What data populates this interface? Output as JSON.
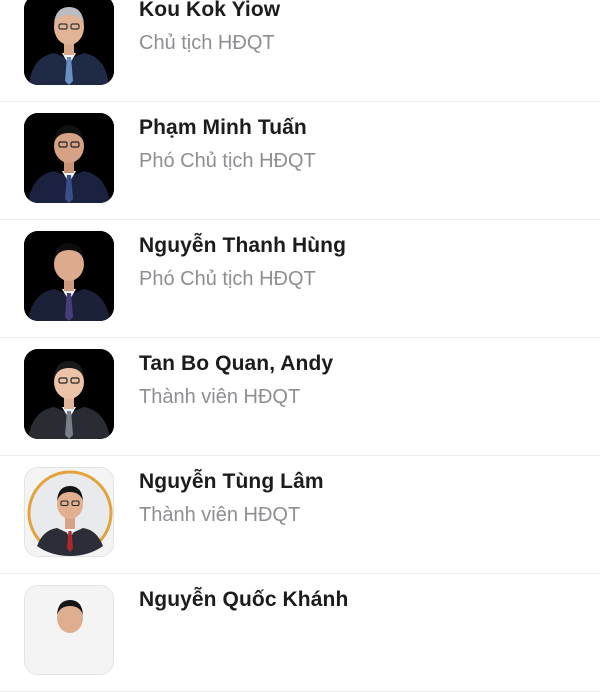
{
  "members": [
    {
      "name": "Kou Kok Yiow",
      "title": "Chủ tịch HĐQT",
      "avatar": "portrait-photo",
      "tie_color": "#6a8fc4",
      "bg": "#000000"
    },
    {
      "name": "Phạm Minh Tuấn",
      "title": "Phó Chủ tịch HĐQT",
      "avatar": "portrait-photo",
      "tie_color": "#3a4f8a",
      "bg": "#000000"
    },
    {
      "name": "Nguyễn Thanh Hùng",
      "title": "Phó Chủ tịch HĐQT",
      "avatar": "portrait-photo",
      "tie_color": "#4a3e7a",
      "bg": "#000000"
    },
    {
      "name": "Tan Bo Quan, Andy",
      "title": "Thành viên HĐQT",
      "avatar": "portrait-photo",
      "tie_color": "#7a7f8a",
      "bg": "#000000"
    },
    {
      "name": "Nguyễn Tùng Lâm",
      "title": "Thành viên HĐQT",
      "avatar": "portrait-photo",
      "tie_color": "#b0262e",
      "bg": "#f4f4f4"
    },
    {
      "name": "Nguyễn Quốc Khánh",
      "title": "",
      "avatar": "portrait-photo",
      "tie_color": "#333333",
      "bg": "#f4f4f4"
    }
  ]
}
